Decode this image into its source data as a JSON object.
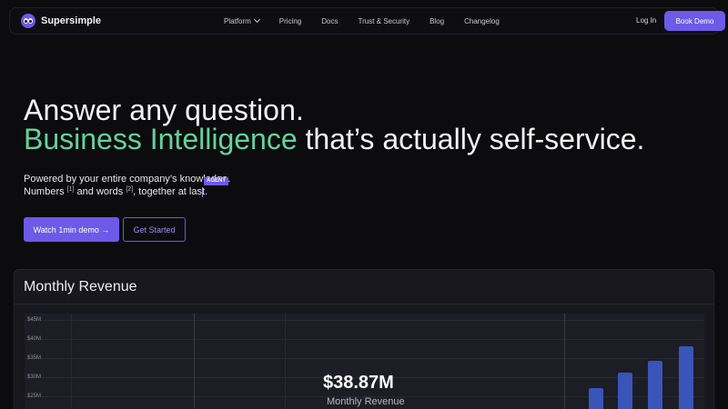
{
  "nav": {
    "brand": "Supersimple",
    "menu": [
      "Platform",
      "Pricing",
      "Docs",
      "Trust & Security",
      "Blog",
      "Changelog"
    ],
    "login": "Log In",
    "book_demo": "Book Demo"
  },
  "hero": {
    "line1": "Answer any question.",
    "accent": "Business Intelligence",
    "line2_rest": " that’s actually self-service.",
    "sub1": "Powered by your entire company’s knowledge.",
    "agent_badge": "AGENT",
    "sub2_a": "Numbers",
    "ref1": "[1]",
    "sub2_b": " and words",
    "ref2": "[2]",
    "sub2_c": ", together at last.",
    "cta_primary": "Watch 1min demo →",
    "cta_secondary": "Get Started"
  },
  "card": {
    "title": "Monthly Revenue",
    "y_ticks": [
      "$45M",
      "$40M",
      "$35M",
      "$30M",
      "$25M"
    ],
    "big_value": "$38.87M",
    "big_label": "Monthly Revenue"
  },
  "colors": {
    "accent": "#6d5ae8",
    "green": "#63d39a",
    "bar": "#3a55b9"
  }
}
